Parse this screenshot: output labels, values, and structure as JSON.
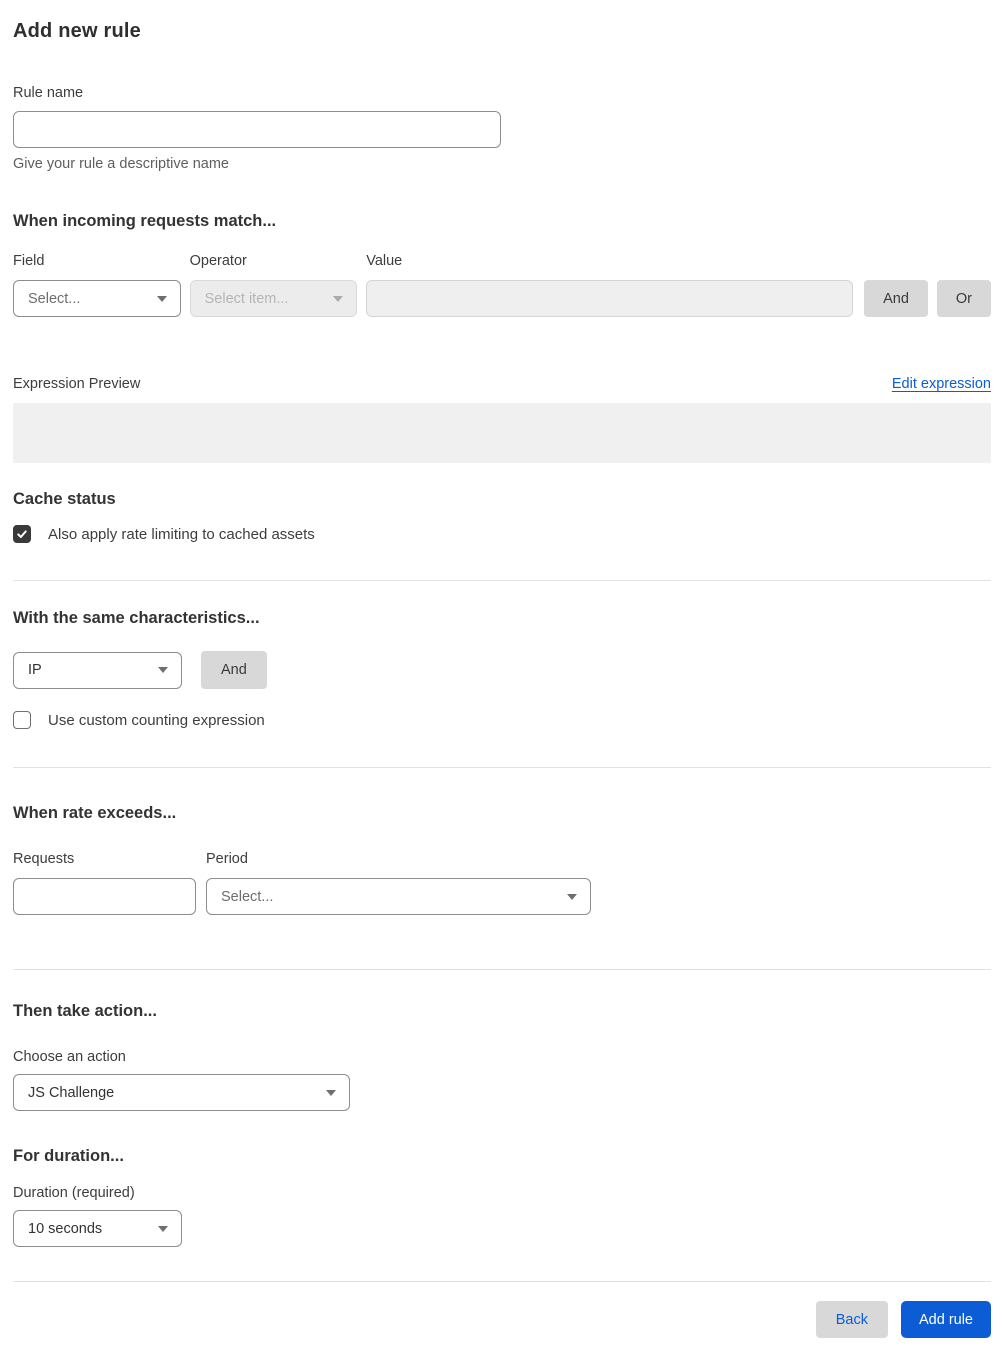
{
  "page": {
    "title": "Add new rule"
  },
  "rule_name": {
    "label": "Rule name",
    "value": "",
    "helper": "Give your rule a descriptive name"
  },
  "match": {
    "heading": "When incoming requests match...",
    "field": {
      "label": "Field",
      "placeholder": "Select..."
    },
    "operator": {
      "label": "Operator",
      "placeholder": "Select item..."
    },
    "value": {
      "label": "Value",
      "value": ""
    },
    "and_label": "And",
    "or_label": "Or"
  },
  "expression": {
    "label": "Expression Preview",
    "edit_link": "Edit expression",
    "preview": ""
  },
  "cache": {
    "heading": "Cache status",
    "checkbox_label": "Also apply rate limiting to cached assets",
    "checked": true
  },
  "characteristics": {
    "heading": "With the same characteristics...",
    "selected": "IP",
    "and_label": "And",
    "checkbox_label": "Use custom counting expression",
    "checked": false
  },
  "rate": {
    "heading": "When rate exceeds...",
    "requests": {
      "label": "Requests",
      "value": ""
    },
    "period": {
      "label": "Period",
      "placeholder": "Select..."
    }
  },
  "action": {
    "heading": "Then take action...",
    "label": "Choose an action",
    "selected": "JS Challenge"
  },
  "duration": {
    "heading": "For duration...",
    "label": "Duration (required)",
    "selected": "10 seconds"
  },
  "footer": {
    "back_label": "Back",
    "add_label": "Add rule"
  },
  "colors": {
    "accent_blue": "#0b5cd5",
    "checkbox_checked": "#3a3a3a",
    "disabled_bg": "#ececec",
    "preview_bg": "#f0f0f0"
  }
}
